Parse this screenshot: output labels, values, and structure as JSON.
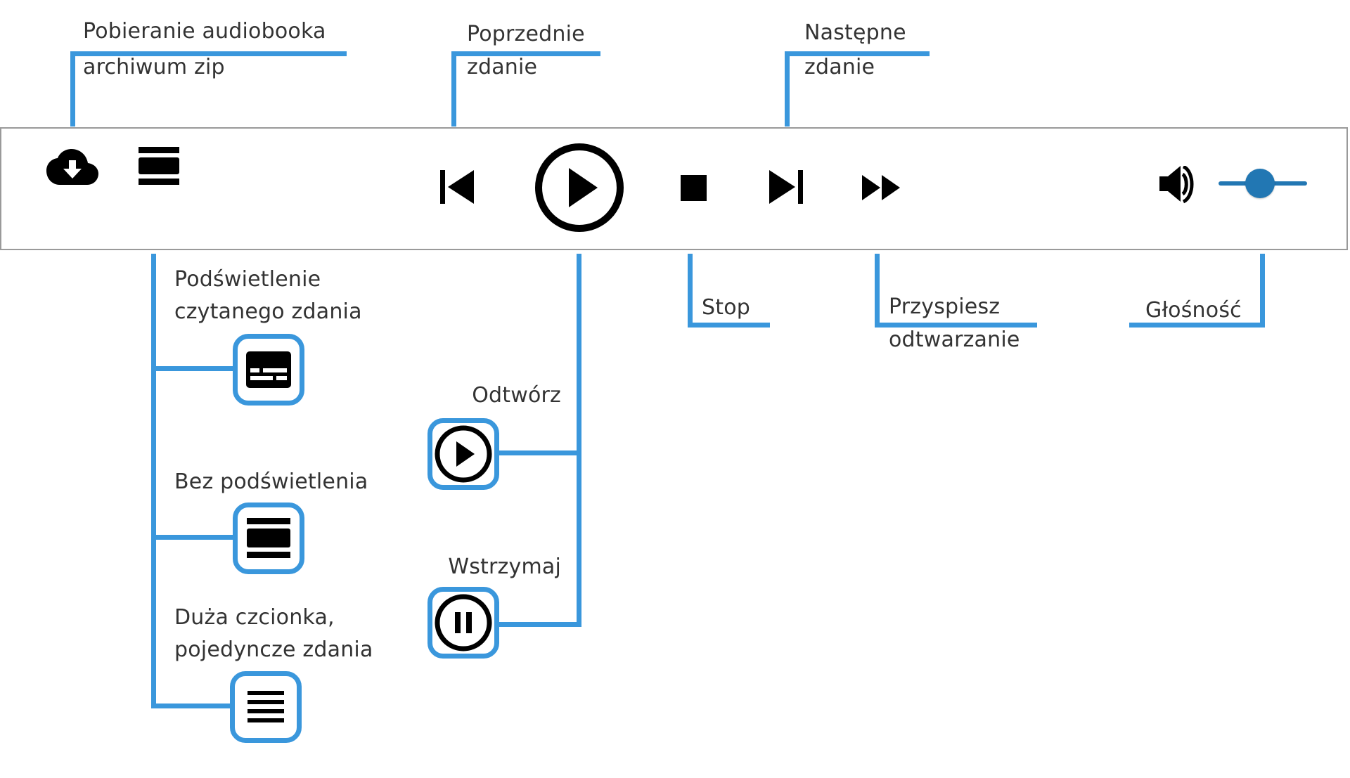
{
  "callouts": {
    "download": {
      "line1": "Pobieranie audiobooka",
      "line2": "archiwum zip",
      "icon": "cloud-download-icon"
    },
    "previous": {
      "line1": "Poprzednie",
      "line2": "zdanie",
      "icon": "skip-previous-icon"
    },
    "next": {
      "line1": "Następne",
      "line2": "zdanie",
      "icon": "skip-next-icon"
    },
    "stop": {
      "line1": "Stop",
      "icon": "stop-icon"
    },
    "fast_forward": {
      "line1": "Przyspiesz",
      "line2": "odtwarzanie",
      "icon": "fast-forward-icon"
    },
    "volume": {
      "line1": "Głośność",
      "icon": "volume-icon"
    },
    "play": {
      "label": "Odtwórz",
      "icon": "play-circle-icon"
    },
    "pause": {
      "label": "Wstrzymaj",
      "icon": "pause-circle-icon"
    },
    "highlight_sentence": {
      "line1": "Podświetlenie",
      "line2": "czytanego zdania",
      "icon": "subtitles-icon"
    },
    "no_highlight": {
      "label": "Bez podświetlenia",
      "icon": "view-agenda-icon"
    },
    "large_font": {
      "line1": "Duża czcionka,",
      "line2": "pojedyncze zdania",
      "icon": "text-lines-icon"
    }
  },
  "toolbar": {
    "buttons": [
      "cloud-download-icon",
      "view-agenda-icon",
      "skip-previous-icon",
      "play-circle-icon",
      "stop-icon",
      "skip-next-icon",
      "fast-forward-icon",
      "volume-icon"
    ],
    "volume_level": 0.47
  },
  "colors": {
    "callout_line": "#3a97dc",
    "slider": "#2277b3",
    "icon": "#000000",
    "text": "#333333"
  }
}
